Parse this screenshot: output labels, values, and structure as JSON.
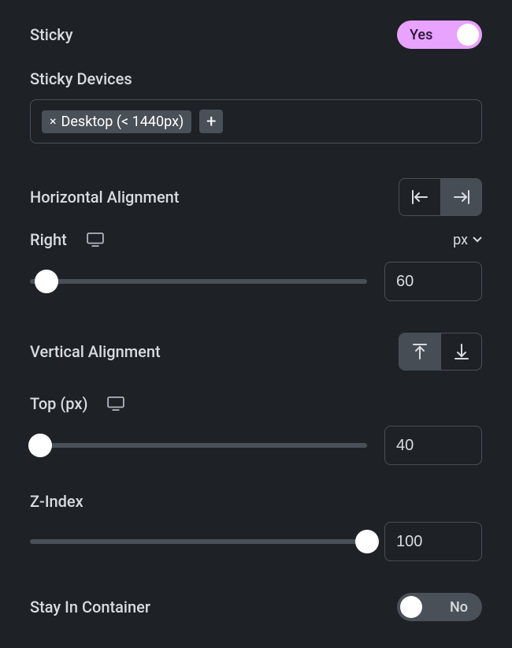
{
  "sticky": {
    "label": "Sticky",
    "value": "Yes"
  },
  "stickyDevices": {
    "label": "Sticky Devices",
    "tag": "Desktop (< 1440px)"
  },
  "horizontalAlignment": {
    "label": "Horizontal Alignment",
    "sub_label": "Right",
    "unit": "px",
    "value": "60",
    "slider_pct": 5
  },
  "verticalAlignment": {
    "label": "Vertical Alignment",
    "sub_label": "Top (px)",
    "value": "40",
    "slider_pct": 3
  },
  "zIndex": {
    "label": "Z-Index",
    "value": "100",
    "slider_pct": 100
  },
  "stayInContainer": {
    "label": "Stay In Container",
    "value": "No"
  }
}
